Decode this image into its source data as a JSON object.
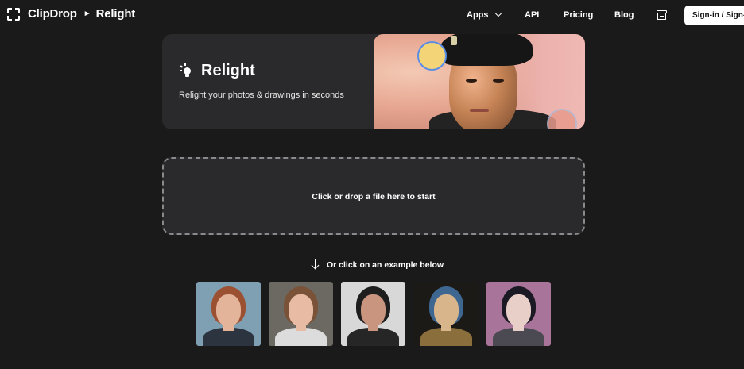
{
  "header": {
    "brand": "ClipDrop",
    "separator": "►",
    "app_name": "Relight",
    "nav": {
      "apps": "Apps",
      "api": "API",
      "pricing": "Pricing",
      "blog": "Blog"
    },
    "signin_label": "Sign-in / Sign-up"
  },
  "hero": {
    "title": "Relight",
    "subtitle": "Relight your photos & drawings in seconds"
  },
  "dropzone": {
    "label": "Click or drop a file here to start"
  },
  "examples": {
    "hint": "Or click on an example below",
    "thumbnails": [
      {
        "bg": "#7f9fb2",
        "skin": "#e3b39a",
        "hair": "#9b5032",
        "body": "#2c3440"
      },
      {
        "bg": "#6c6862",
        "skin": "#e8bca4",
        "hair": "#7a5237",
        "body": "#dcdcdc"
      },
      {
        "bg": "#d8d8d8",
        "skin": "#c9957e",
        "hair": "#1e1e1e",
        "body": "#262626"
      },
      {
        "bg": "#1c1a16",
        "skin": "#d8b58a",
        "hair": "#3d6690",
        "body": "#8a6f3c"
      },
      {
        "bg": "#a9749a",
        "skin": "#e8cfc8",
        "hair": "#1b1a24",
        "body": "#4b4a52"
      }
    ]
  },
  "colors": {
    "page_bg": "#1a1a1a",
    "card_bg": "#2a2a2c",
    "accent_ring": "#5a8ee6"
  }
}
